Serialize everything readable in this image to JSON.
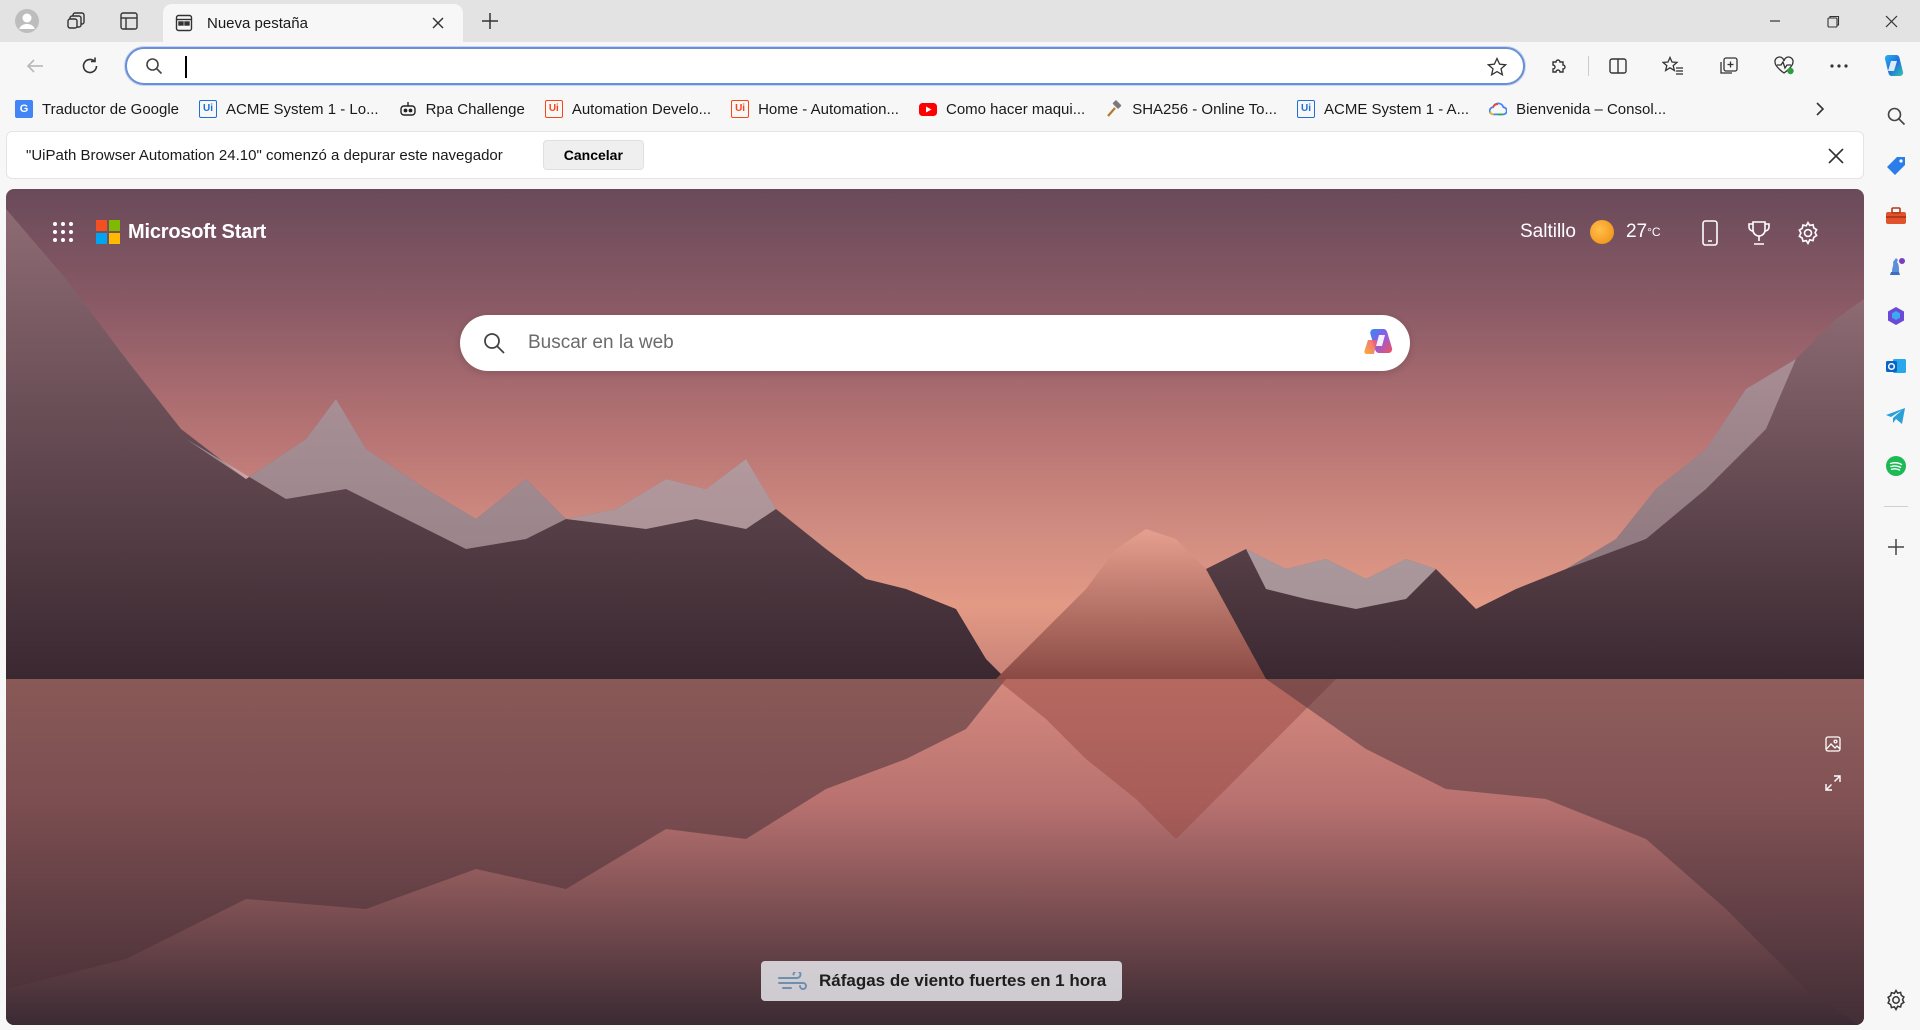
{
  "window": {
    "tab_title": "Nueva pestaña",
    "controls": {
      "minimize": "minimize-icon",
      "maximize": "restore-icon",
      "close": "close-icon"
    }
  },
  "addressbar": {
    "value": "",
    "placeholder": ""
  },
  "favorites": [
    {
      "label": "Traductor de Google",
      "icon": "google-translate-icon",
      "color": "#4285f4"
    },
    {
      "label": "ACME System 1 - Lo...",
      "icon": "uipath-icon",
      "color": "#1e6fd6"
    },
    {
      "label": "Rpa Challenge",
      "icon": "robot-icon",
      "color": "#222222"
    },
    {
      "label": "Automation Develo...",
      "icon": "uipath-icon",
      "color": "#fa4616"
    },
    {
      "label": "Home - Automation...",
      "icon": "uipath-icon",
      "color": "#fa4616"
    },
    {
      "label": "Como hacer maqui...",
      "icon": "youtube-icon",
      "color": "#ff0000"
    },
    {
      "label": "SHA256 - Online To...",
      "icon": "hammer-icon",
      "color": "#b07a2a"
    },
    {
      "label": "ACME System 1 - A...",
      "icon": "uipath-icon",
      "color": "#1e6fd6"
    },
    {
      "label": "Bienvenida – Consol...",
      "icon": "google-cloud-icon",
      "color": "#ea4335"
    }
  ],
  "infobar": {
    "message": "\"UiPath Browser Automation 24.10\" comenzó a depurar este navegador",
    "cancel": "Cancelar"
  },
  "ntp": {
    "brand": "Microsoft Start",
    "logo_colors": [
      "#f25022",
      "#7fba00",
      "#00a4ef",
      "#ffb900"
    ],
    "weather": {
      "city": "Saltillo",
      "temp": "27",
      "unit": "°C"
    },
    "search_placeholder": "Buscar en la web",
    "alert": "Ráfagas de viento fuertes en 1 hora"
  },
  "sidebar": [
    "search-icon",
    "tag-icon",
    "toolbox-icon",
    "chess-icon",
    "copilot-apps-icon",
    "outlook-icon",
    "telegram-icon",
    "spotify-icon",
    "add-icon",
    "settings-icon"
  ]
}
